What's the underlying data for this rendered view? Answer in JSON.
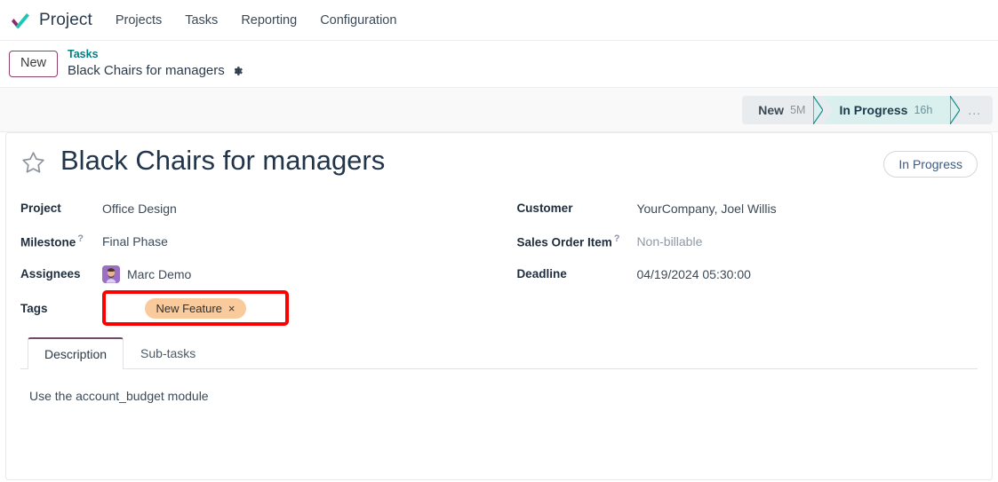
{
  "navbar": {
    "brand": "Project",
    "logo_icon": "odoo-check-logo",
    "menu": [
      {
        "label": "Projects"
      },
      {
        "label": "Tasks"
      },
      {
        "label": "Reporting"
      },
      {
        "label": "Configuration"
      }
    ]
  },
  "breadcrumb": {
    "new_button": "New",
    "parent": "Tasks",
    "current": "Black Chairs for managers",
    "settings_icon": "gear-icon"
  },
  "statusbar": {
    "steps": [
      {
        "label": "New",
        "duration": "5M",
        "active": false
      },
      {
        "label": "In Progress",
        "duration": "16h",
        "active": true
      }
    ],
    "overflow": "...",
    "active_color": "#d9f0ef",
    "active_border_color": "#0e8a8f",
    "inactive_bg": "#e9ecef"
  },
  "record": {
    "priority_icon": "star-outline-icon",
    "title": "Black Chairs for managers",
    "stage_button": "In Progress"
  },
  "fields_left": [
    {
      "label": "Project",
      "help": "",
      "value": "Office Design",
      "muted": false,
      "avatar": false
    },
    {
      "label": "Milestone",
      "help": "?",
      "value": "Final Phase",
      "muted": false,
      "avatar": false
    },
    {
      "label": "Assignees",
      "help": "",
      "value": "Marc Demo",
      "muted": false,
      "avatar": true
    }
  ],
  "fields_right": [
    {
      "label": "Customer",
      "help": "",
      "value": "YourCompany, Joel Willis",
      "muted": false
    },
    {
      "label": "Sales Order Item",
      "help": "?",
      "value": "Non-billable",
      "muted": true
    },
    {
      "label": "Deadline",
      "help": "",
      "value": "04/19/2024 05:30:00",
      "muted": false
    }
  ],
  "tags": {
    "label": "Tags",
    "items": [
      {
        "name": "New Feature",
        "remove": "×",
        "color": "#f9cb9c"
      }
    ],
    "highlight_color": "#ff0000"
  },
  "notebook": {
    "tabs": [
      {
        "label": "Description",
        "active": true
      },
      {
        "label": "Sub-tasks",
        "active": false
      }
    ],
    "description_text": "Use the account_budget module"
  }
}
